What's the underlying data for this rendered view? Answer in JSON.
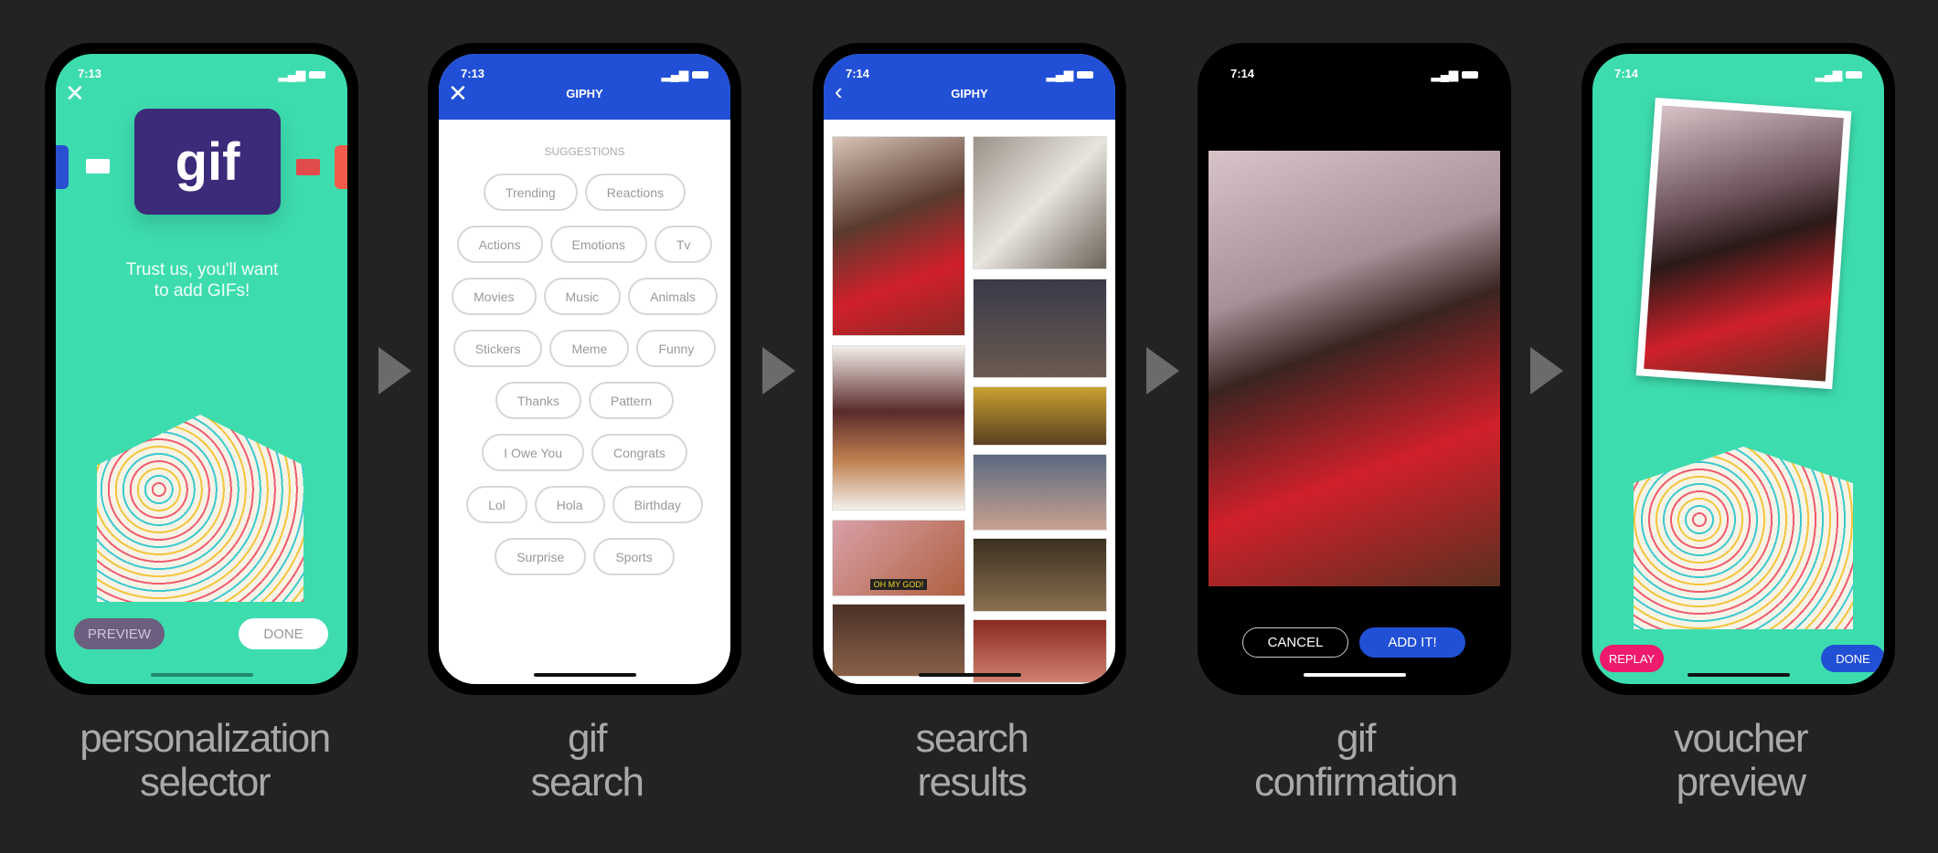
{
  "steps": [
    {
      "label_line1": "personalization",
      "label_line2": "selector"
    },
    {
      "label_line1": "gif",
      "label_line2": "search"
    },
    {
      "label_line1": "search",
      "label_line2": "results"
    },
    {
      "label_line1": "gif",
      "label_line2": "confirmation"
    },
    {
      "label_line1": "voucher",
      "label_line2": "preview"
    }
  ],
  "phone1": {
    "time": "7:13",
    "gif_card_text": "gif",
    "heading": "Trust us, you'll want to add GIFs!",
    "preview_label": "PREVIEW",
    "done_label": "DONE",
    "colors": {
      "background": "#3ddcae",
      "card": "#3c2a7a"
    }
  },
  "phone2": {
    "time": "7:13",
    "title": "GIPHY",
    "suggestions_title": "SUGGESTIONS",
    "suggestion_rows": [
      [
        "Trending",
        "Reactions"
      ],
      [
        "Actions",
        "Emotions",
        "Tv"
      ],
      [
        "Movies",
        "Music",
        "Animals"
      ],
      [
        "Stickers",
        "Meme",
        "Funny"
      ],
      [
        "Thanks",
        "Pattern"
      ],
      [
        "I Owe You",
        "Congrats"
      ],
      [
        "Lol",
        "Hola",
        "Birthday"
      ],
      [
        "Surprise",
        "Sports"
      ]
    ],
    "colors": {
      "header": "#2150d6"
    }
  },
  "phone3": {
    "time": "7:14",
    "title": "GIPHY",
    "tile_caption": "OH MY GOD!"
  },
  "phone4": {
    "time": "7:14",
    "cancel_label": "CANCEL",
    "add_label": "ADD IT!",
    "colors": {
      "add": "#2150d6"
    }
  },
  "phone5": {
    "time": "7:14",
    "replay_label": "REPLAY",
    "done_label": "DONE",
    "colors": {
      "replay": "#ee1a6e",
      "done": "#2150d6"
    }
  }
}
